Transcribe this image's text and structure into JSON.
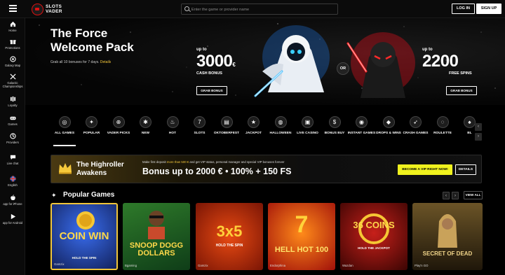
{
  "topbar": {
    "logo_line1": "SLOTS",
    "logo_line2": "VADER",
    "search_placeholder": "Enter the game or provider name",
    "login": "LOG IN",
    "signup": "SIGN UP"
  },
  "sidebar": {
    "items": [
      {
        "label": "Home",
        "icon": "home-icon"
      },
      {
        "label": "Promotions",
        "icon": "gift-icon"
      },
      {
        "label": "Galaxy Map",
        "icon": "map-icon"
      },
      {
        "label": "Galactic Championships",
        "icon": "swords-icon"
      },
      {
        "label": "Loyalty",
        "icon": "loyalty-icon"
      },
      {
        "label": "Games",
        "icon": "gamepad-icon"
      },
      {
        "label": "Providers",
        "icon": "providers-icon"
      },
      {
        "label": "Live chat",
        "icon": "chat-icon"
      },
      {
        "label": "English",
        "icon": "uk-flag-icon"
      },
      {
        "label": "app for iPhone",
        "icon": "apple-icon"
      },
      {
        "label": "app for Android",
        "icon": "play-store-icon"
      }
    ]
  },
  "hero": {
    "title": "The Force Welcome Pack",
    "subtitle": "Grab all 10 bonuses for 7 days.",
    "details_link": "Details",
    "left_upto": "up to",
    "left_amount": "3000",
    "left_currency": "€",
    "left_label": "CASH BONUS",
    "left_button": "GRAB BONUS",
    "or": "OR",
    "right_upto": "up to",
    "right_amount": "2200",
    "right_label": "FREE SPINS",
    "right_button": "GRAB BONUS"
  },
  "categories": [
    {
      "label": "ALL GAMES",
      "icon": "all-games-icon",
      "active": true
    },
    {
      "label": "POPULAR",
      "icon": "sparkle-icon"
    },
    {
      "label": "VADER PICKS",
      "icon": "crosshair-icon"
    },
    {
      "label": "NEW",
      "icon": "new-icon"
    },
    {
      "label": "HOT",
      "icon": "flame-icon"
    },
    {
      "label": "SLOTS",
      "icon": "slot-777-icon"
    },
    {
      "label": "OKTOBERFEST",
      "icon": "beer-icon"
    },
    {
      "label": "JACKPOT",
      "icon": "jackpot-icon"
    },
    {
      "label": "HALLOWEEN",
      "icon": "pumpkin-icon"
    },
    {
      "label": "LIVE CASINO",
      "icon": "live-casino-icon"
    },
    {
      "label": "BONUS BUY",
      "icon": "bonus-buy-icon"
    },
    {
      "label": "INSTANT GAMES",
      "icon": "instant-icon"
    },
    {
      "label": "DROPS & WINS",
      "icon": "drops-icon"
    },
    {
      "label": "CRASH GAMES",
      "icon": "rocket-icon"
    },
    {
      "label": "ROULETTE",
      "icon": "roulette-icon"
    },
    {
      "label": "BL",
      "icon": "blackjack-icon"
    }
  ],
  "banner": {
    "title": "The Highroller Awakens",
    "line_before": "Make first deposit",
    "line_highlight": "more than 500 €",
    "line_after": "and get VIP status, personal manager and special VIP bonuses forever",
    "bonus": "Bonus up to 2000 € • 100% + 150 FS",
    "vip_button": "BECOME A VIP RIGHT NOW!",
    "details_button": "DETAILS"
  },
  "popular": {
    "title": "Popular Games",
    "view_all": "VIEW ALL",
    "games": [
      {
        "title": "COIN WIN",
        "subtitle": "HOLD THE SPIN",
        "provider": "Gamzix"
      },
      {
        "title": "SNOOP DOGG DOLLARS",
        "provider": "Bgaming"
      },
      {
        "title": "3x5",
        "subtitle": "HOLD THE SPIN",
        "provider": "Gamzix"
      },
      {
        "title": "HELL HOT 100",
        "provider": "Endorphina"
      },
      {
        "title": "36 COINS",
        "subtitle": "HOLD THE JACKPOT",
        "provider": "Wazdan"
      },
      {
        "title": "SECRET OF DEAD",
        "provider": "Play'n GO"
      }
    ]
  },
  "colors": {
    "accent_yellow": "#f6c93b",
    "vip_button": "#f0f21e",
    "sith_red": "#e01818",
    "jedi_blue": "#36a7ff"
  }
}
